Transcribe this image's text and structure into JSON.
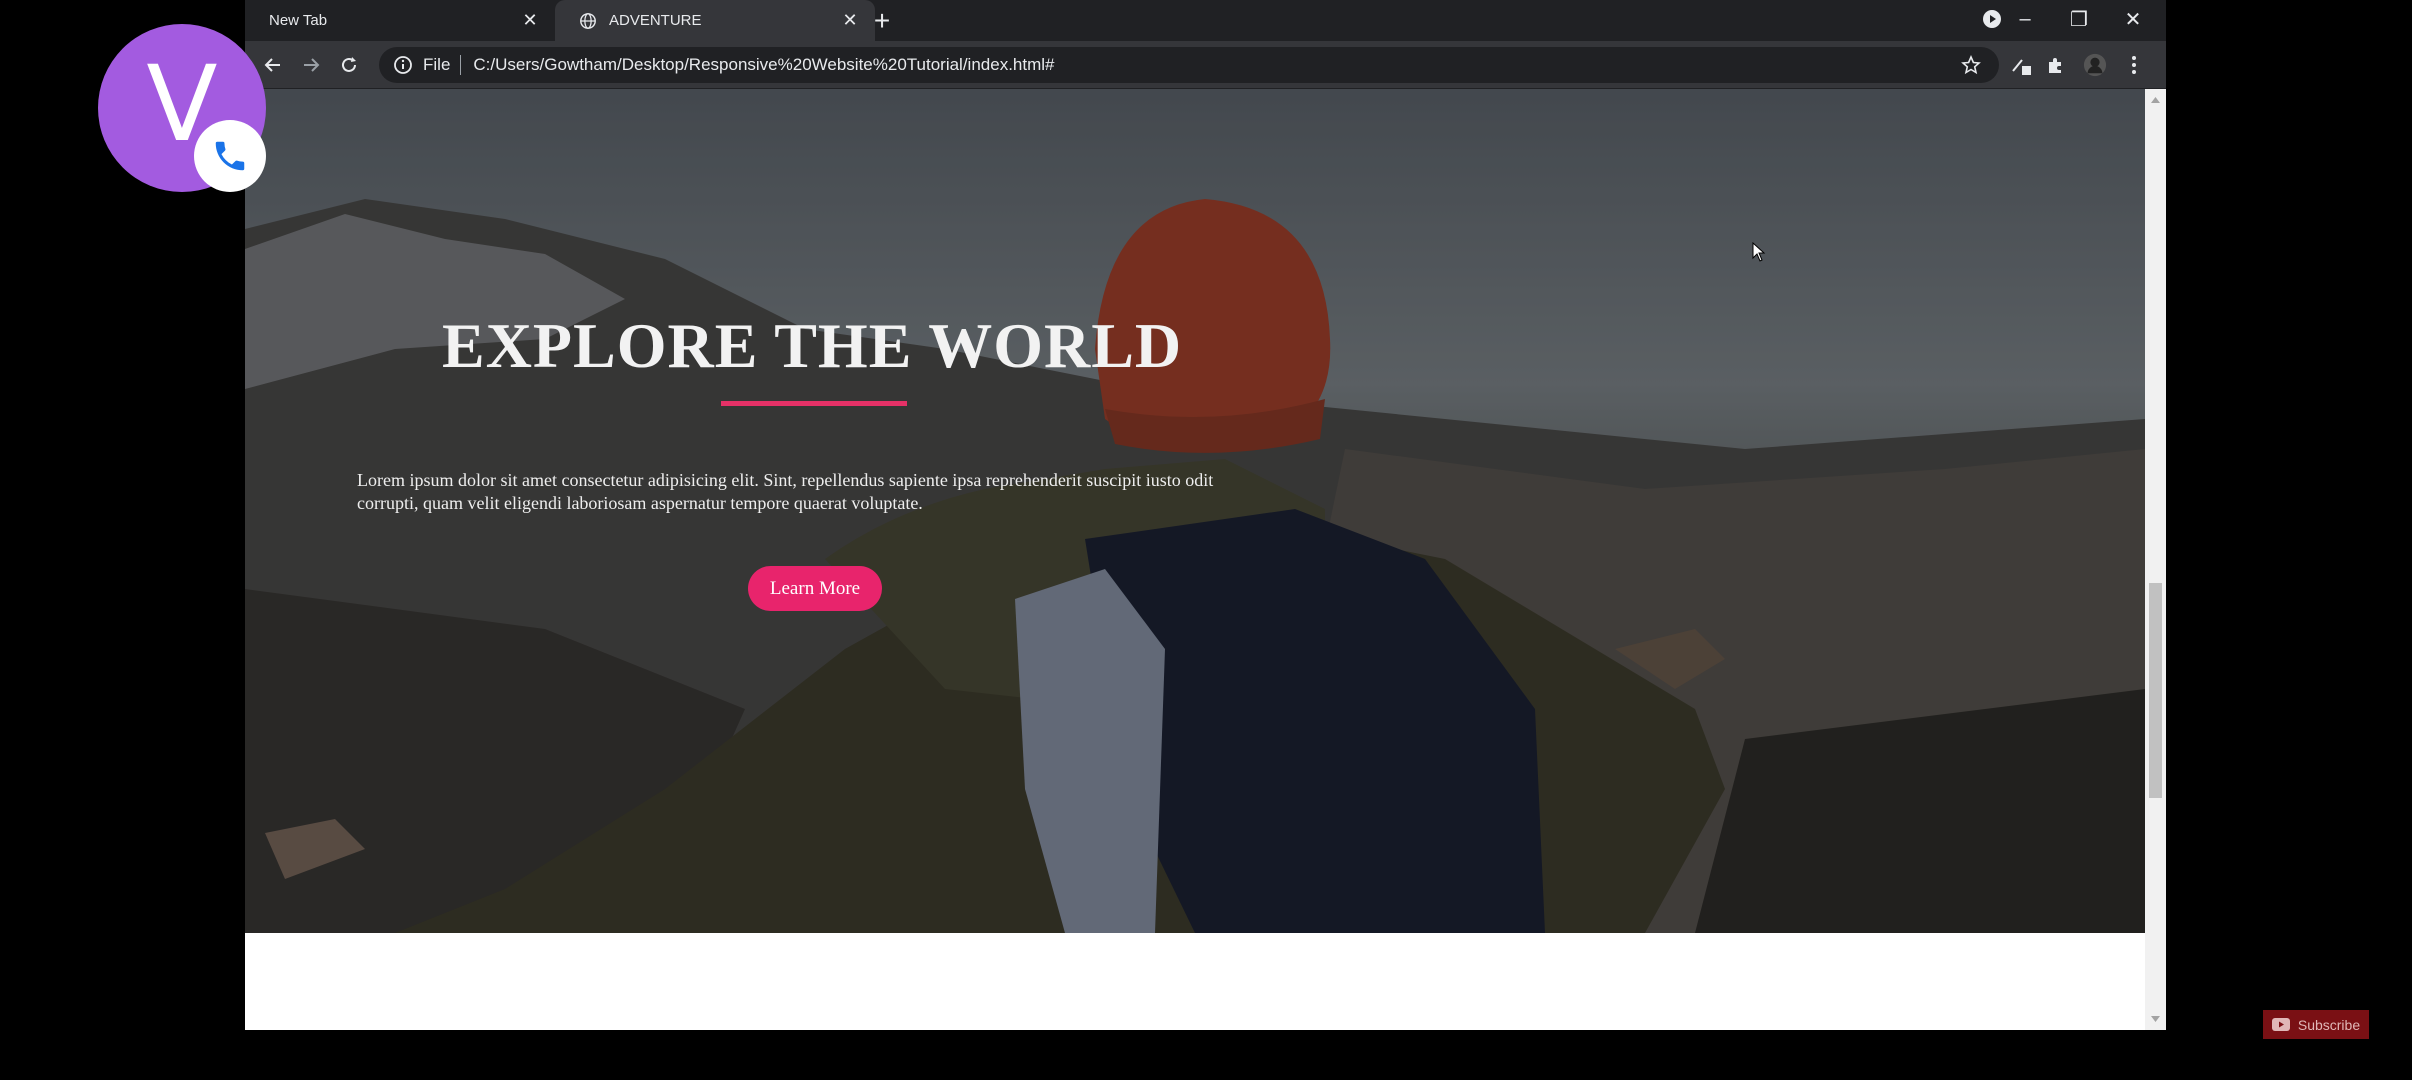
{
  "browser": {
    "tabs": [
      {
        "title": "New Tab",
        "active": false
      },
      {
        "title": "ADVENTURE",
        "active": true
      }
    ],
    "address_bar": {
      "scheme_label": "File",
      "url": "C:/Users/Gowtham/Desktop/Responsive%20Website%20Tutorial/index.html#"
    }
  },
  "hero": {
    "title": "EXPLORE THE WORLD",
    "description": "Lorem ipsum dolor sit amet consectetur adipisicing elit. Sint, repellendus sapiente ipsa reprehenderit suscipit iusto odit corrupti, quam velit eligendi laboriosam aspernatur tempore quaerat voluptate.",
    "cta_label": "Learn More",
    "accent_color": "#e8246c"
  },
  "overlay": {
    "avatar_letter": "V",
    "avatar_color": "#a35be0",
    "subscribe_label": "Subscribe"
  }
}
